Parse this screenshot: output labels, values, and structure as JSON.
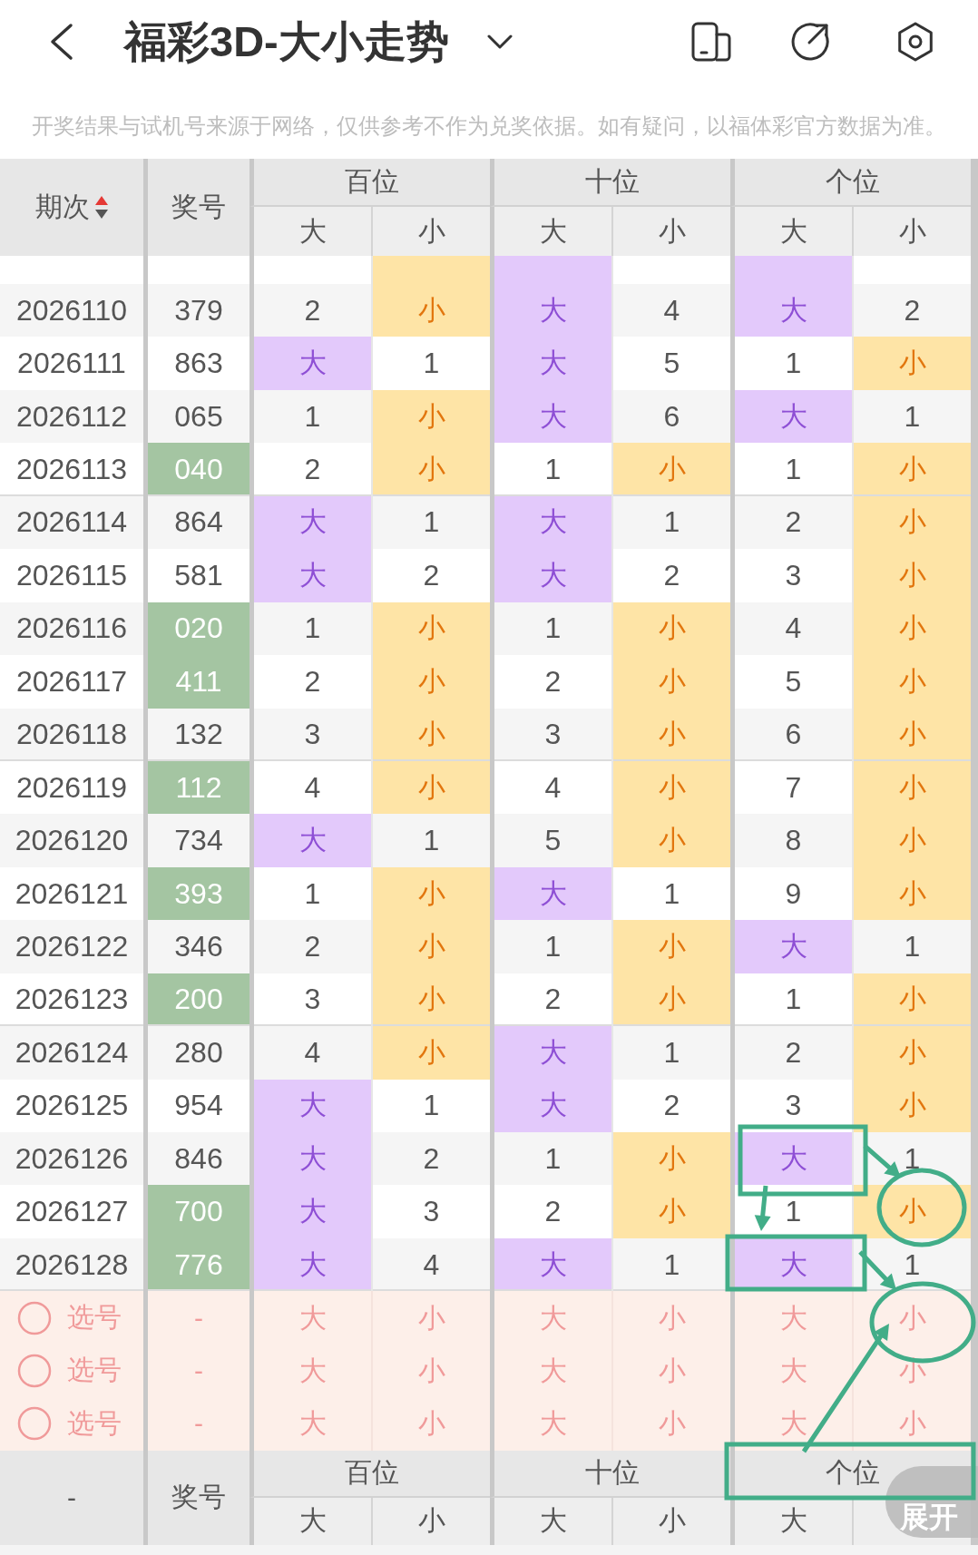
{
  "top_bar": {
    "title": "福彩3D-大小走势"
  },
  "notice": "开奖结果与试机号来源于网络，仅供参考不作为兑奖依据。如有疑问，以福体彩官方数据为准。",
  "table": {
    "header": {
      "issue": {
        "label": "期次",
        "sort_ascending": true
      },
      "number": "奖号",
      "groups": [
        {
          "label": "百位",
          "columns": [
            "大",
            "小"
          ]
        },
        {
          "label": "十位",
          "columns": [
            "大",
            "小"
          ]
        },
        {
          "label": "个位",
          "columns": [
            "大",
            "小"
          ]
        }
      ]
    },
    "cut_row": {
      "cells": [
        {
          "kind": "count"
        },
        {
          "kind": "small"
        },
        {
          "kind": "big"
        },
        {
          "kind": "count"
        },
        {
          "kind": "big"
        },
        {
          "kind": "count"
        }
      ]
    },
    "rows": [
      {
        "issue": "2026110",
        "number": "379",
        "pair": false,
        "cells": [
          {
            "text": "2",
            "kind": "count"
          },
          {
            "text": "小",
            "kind": "small"
          },
          {
            "text": "大",
            "kind": "big"
          },
          {
            "text": "4",
            "kind": "count"
          },
          {
            "text": "大",
            "kind": "big"
          },
          {
            "text": "2",
            "kind": "count"
          }
        ]
      },
      {
        "issue": "2026111",
        "number": "863",
        "pair": false,
        "cells": [
          {
            "text": "大",
            "kind": "big"
          },
          {
            "text": "1",
            "kind": "count"
          },
          {
            "text": "大",
            "kind": "big"
          },
          {
            "text": "5",
            "kind": "count"
          },
          {
            "text": "1",
            "kind": "count"
          },
          {
            "text": "小",
            "kind": "small"
          }
        ]
      },
      {
        "issue": "2026112",
        "number": "065",
        "pair": false,
        "cells": [
          {
            "text": "1",
            "kind": "count"
          },
          {
            "text": "小",
            "kind": "small"
          },
          {
            "text": "大",
            "kind": "big"
          },
          {
            "text": "6",
            "kind": "count"
          },
          {
            "text": "大",
            "kind": "big"
          },
          {
            "text": "1",
            "kind": "count"
          }
        ]
      },
      {
        "issue": "2026113",
        "number": "040",
        "pair": true,
        "cells": [
          {
            "text": "2",
            "kind": "count"
          },
          {
            "text": "小",
            "kind": "small"
          },
          {
            "text": "1",
            "kind": "count"
          },
          {
            "text": "小",
            "kind": "small"
          },
          {
            "text": "1",
            "kind": "count"
          },
          {
            "text": "小",
            "kind": "small"
          }
        ]
      },
      {
        "issue": "2026114",
        "number": "864",
        "pair": false,
        "cells": [
          {
            "text": "大",
            "kind": "big"
          },
          {
            "text": "1",
            "kind": "count"
          },
          {
            "text": "大",
            "kind": "big"
          },
          {
            "text": "1",
            "kind": "count"
          },
          {
            "text": "2",
            "kind": "count"
          },
          {
            "text": "小",
            "kind": "small"
          }
        ]
      },
      {
        "issue": "2026115",
        "number": "581",
        "pair": false,
        "cells": [
          {
            "text": "大",
            "kind": "big"
          },
          {
            "text": "2",
            "kind": "count"
          },
          {
            "text": "大",
            "kind": "big"
          },
          {
            "text": "2",
            "kind": "count"
          },
          {
            "text": "3",
            "kind": "count"
          },
          {
            "text": "小",
            "kind": "small"
          }
        ]
      },
      {
        "issue": "2026116",
        "number": "020",
        "pair": true,
        "cells": [
          {
            "text": "1",
            "kind": "count"
          },
          {
            "text": "小",
            "kind": "small"
          },
          {
            "text": "1",
            "kind": "count"
          },
          {
            "text": "小",
            "kind": "small"
          },
          {
            "text": "4",
            "kind": "count"
          },
          {
            "text": "小",
            "kind": "small"
          }
        ]
      },
      {
        "issue": "2026117",
        "number": "411",
        "pair": true,
        "cells": [
          {
            "text": "2",
            "kind": "count"
          },
          {
            "text": "小",
            "kind": "small"
          },
          {
            "text": "2",
            "kind": "count"
          },
          {
            "text": "小",
            "kind": "small"
          },
          {
            "text": "5",
            "kind": "count"
          },
          {
            "text": "小",
            "kind": "small"
          }
        ]
      },
      {
        "issue": "2026118",
        "number": "132",
        "pair": false,
        "cells": [
          {
            "text": "3",
            "kind": "count"
          },
          {
            "text": "小",
            "kind": "small"
          },
          {
            "text": "3",
            "kind": "count"
          },
          {
            "text": "小",
            "kind": "small"
          },
          {
            "text": "6",
            "kind": "count"
          },
          {
            "text": "小",
            "kind": "small"
          }
        ]
      },
      {
        "issue": "2026119",
        "number": "112",
        "pair": true,
        "cells": [
          {
            "text": "4",
            "kind": "count"
          },
          {
            "text": "小",
            "kind": "small"
          },
          {
            "text": "4",
            "kind": "count"
          },
          {
            "text": "小",
            "kind": "small"
          },
          {
            "text": "7",
            "kind": "count"
          },
          {
            "text": "小",
            "kind": "small"
          }
        ]
      },
      {
        "issue": "2026120",
        "number": "734",
        "pair": false,
        "cells": [
          {
            "text": "大",
            "kind": "big"
          },
          {
            "text": "1",
            "kind": "count"
          },
          {
            "text": "5",
            "kind": "count"
          },
          {
            "text": "小",
            "kind": "small"
          },
          {
            "text": "8",
            "kind": "count"
          },
          {
            "text": "小",
            "kind": "small"
          }
        ]
      },
      {
        "issue": "2026121",
        "number": "393",
        "pair": true,
        "cells": [
          {
            "text": "1",
            "kind": "count"
          },
          {
            "text": "小",
            "kind": "small"
          },
          {
            "text": "大",
            "kind": "big"
          },
          {
            "text": "1",
            "kind": "count"
          },
          {
            "text": "9",
            "kind": "count"
          },
          {
            "text": "小",
            "kind": "small"
          }
        ]
      },
      {
        "issue": "2026122",
        "number": "346",
        "pair": false,
        "cells": [
          {
            "text": "2",
            "kind": "count"
          },
          {
            "text": "小",
            "kind": "small"
          },
          {
            "text": "1",
            "kind": "count"
          },
          {
            "text": "小",
            "kind": "small"
          },
          {
            "text": "大",
            "kind": "big"
          },
          {
            "text": "1",
            "kind": "count"
          }
        ]
      },
      {
        "issue": "2026123",
        "number": "200",
        "pair": true,
        "cells": [
          {
            "text": "3",
            "kind": "count"
          },
          {
            "text": "小",
            "kind": "small"
          },
          {
            "text": "2",
            "kind": "count"
          },
          {
            "text": "小",
            "kind": "small"
          },
          {
            "text": "1",
            "kind": "count"
          },
          {
            "text": "小",
            "kind": "small"
          }
        ]
      },
      {
        "issue": "2026124",
        "number": "280",
        "pair": false,
        "cells": [
          {
            "text": "4",
            "kind": "count"
          },
          {
            "text": "小",
            "kind": "small"
          },
          {
            "text": "大",
            "kind": "big"
          },
          {
            "text": "1",
            "kind": "count"
          },
          {
            "text": "2",
            "kind": "count"
          },
          {
            "text": "小",
            "kind": "small"
          }
        ]
      },
      {
        "issue": "2026125",
        "number": "954",
        "pair": false,
        "cells": [
          {
            "text": "大",
            "kind": "big"
          },
          {
            "text": "1",
            "kind": "count"
          },
          {
            "text": "大",
            "kind": "big"
          },
          {
            "text": "2",
            "kind": "count"
          },
          {
            "text": "3",
            "kind": "count"
          },
          {
            "text": "小",
            "kind": "small"
          }
        ]
      },
      {
        "issue": "2026126",
        "number": "846",
        "pair": false,
        "cells": [
          {
            "text": "大",
            "kind": "big"
          },
          {
            "text": "2",
            "kind": "count"
          },
          {
            "text": "1",
            "kind": "count"
          },
          {
            "text": "小",
            "kind": "small"
          },
          {
            "text": "大",
            "kind": "big"
          },
          {
            "text": "1",
            "kind": "count"
          }
        ]
      },
      {
        "issue": "2026127",
        "number": "700",
        "pair": true,
        "cells": [
          {
            "text": "大",
            "kind": "big"
          },
          {
            "text": "3",
            "kind": "count"
          },
          {
            "text": "2",
            "kind": "count"
          },
          {
            "text": "小",
            "kind": "small"
          },
          {
            "text": "1",
            "kind": "count"
          },
          {
            "text": "小",
            "kind": "small"
          }
        ]
      },
      {
        "issue": "2026128",
        "number": "776",
        "pair": true,
        "cells": [
          {
            "text": "大",
            "kind": "big"
          },
          {
            "text": "4",
            "kind": "count"
          },
          {
            "text": "大",
            "kind": "big"
          },
          {
            "text": "1",
            "kind": "count"
          },
          {
            "text": "大",
            "kind": "big"
          },
          {
            "text": "1",
            "kind": "count"
          }
        ]
      }
    ],
    "picks": [
      {
        "label": "选号",
        "checked": false,
        "number": "-",
        "options": [
          {
            "text": "大",
            "selected": false
          },
          {
            "text": "小",
            "selected": false
          },
          {
            "text": "大",
            "selected": false
          },
          {
            "text": "小",
            "selected": false
          },
          {
            "text": "大",
            "selected": false
          },
          {
            "text": "小",
            "selected": false
          }
        ]
      },
      {
        "label": "选号",
        "checked": false,
        "number": "-",
        "options": [
          {
            "text": "大",
            "selected": false
          },
          {
            "text": "小",
            "selected": false
          },
          {
            "text": "大",
            "selected": false
          },
          {
            "text": "小",
            "selected": false
          },
          {
            "text": "大",
            "selected": false
          },
          {
            "text": "小",
            "selected": false
          }
        ]
      },
      {
        "label": "选号",
        "checked": false,
        "number": "-",
        "options": [
          {
            "text": "大",
            "selected": false
          },
          {
            "text": "小",
            "selected": false
          },
          {
            "text": "大",
            "selected": false
          },
          {
            "text": "小",
            "selected": false
          },
          {
            "text": "大",
            "selected": false
          },
          {
            "text": "小",
            "selected": false
          }
        ]
      }
    ],
    "footer_header": {
      "issue": "-",
      "number": "奖号",
      "groups": [
        {
          "label": "百位",
          "columns": [
            "大",
            "小"
          ]
        },
        {
          "label": "十位",
          "columns": [
            "大",
            "小"
          ]
        },
        {
          "label": "个位",
          "columns": [
            "大"
          ]
        }
      ]
    }
  },
  "expand_button": "展开",
  "annotations": [
    {
      "kind": "rectangle"
    },
    {
      "kind": "arrow"
    },
    {
      "kind": "arrow"
    },
    {
      "kind": "circle"
    },
    {
      "kind": "rectangle"
    },
    {
      "kind": "arrow"
    },
    {
      "kind": "circle"
    },
    {
      "kind": "arrow"
    },
    {
      "kind": "rectangle"
    }
  ]
}
